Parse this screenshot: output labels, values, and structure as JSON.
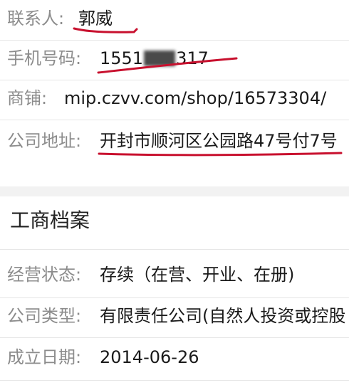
{
  "contact": {
    "contact_person_label": "联系人:",
    "contact_person_value": "郭威",
    "phone_label": "手机号码:",
    "phone_prefix": "1551",
    "phone_suffix": "317",
    "shop_label": "商铺:",
    "shop_value": "mip.czvv.com/shop/16573304/",
    "address_label": "公司地址:",
    "address_value": "开封市顺河区公园路47号付7号"
  },
  "business_record": {
    "section_title": "工商档案",
    "status_label": "经营状态:",
    "status_value": "存续（在营、开业、在册)",
    "type_label": "公司类型:",
    "type_value": "有限责任公司(自然人投资或控股",
    "founded_label": "成立日期:",
    "founded_value": "2014-06-26"
  },
  "colors": {
    "annotation_red": "#c8102e",
    "label_gray": "#8c8c8c",
    "text_dark": "#1a1a1a",
    "divider": "#e6e6e6",
    "section_gap": "#f2f2f2"
  }
}
